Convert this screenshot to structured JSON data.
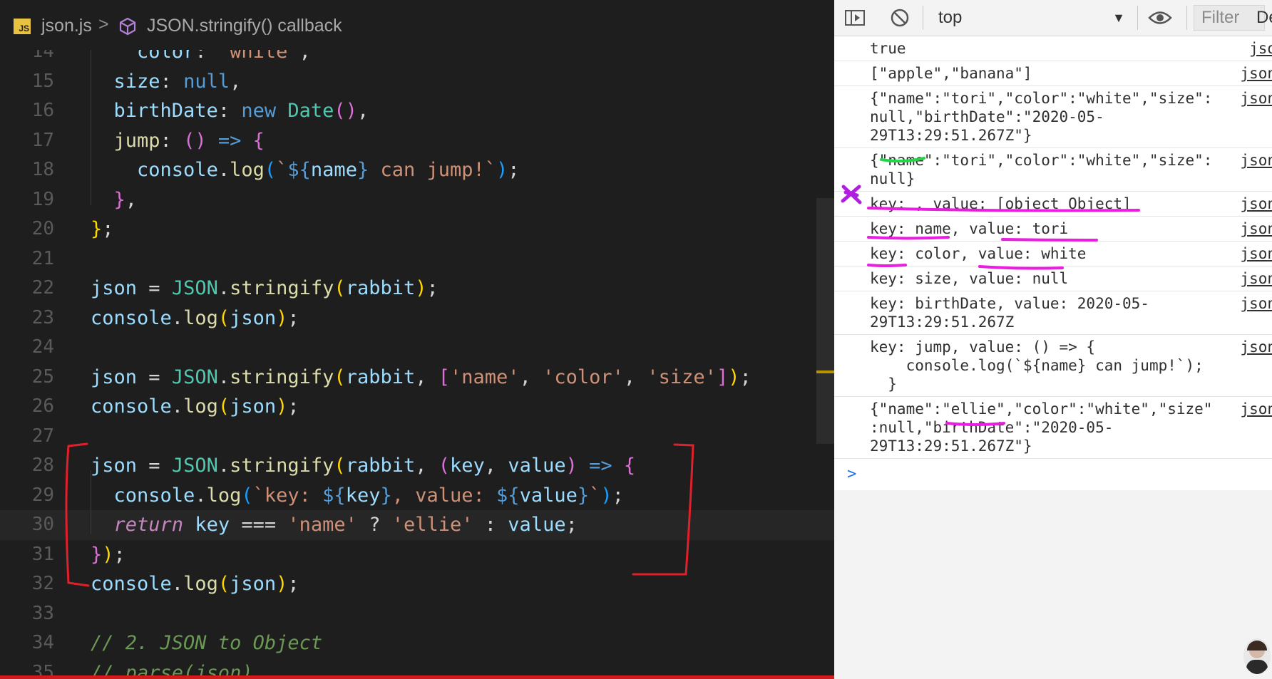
{
  "editor": {
    "breadcrumb": {
      "file_badge": "JS",
      "file": "json.js",
      "separator": ">",
      "symbol": "JSON.stringify() callback"
    }
  },
  "console": {
    "toolbar": {
      "context": "top",
      "filter_placeholder": "Filter",
      "more_label": "De"
    },
    "logs": [
      {
        "text": "true",
        "source": "jso"
      },
      {
        "text": "[\"apple\",\"banana\"]",
        "source": "json"
      },
      {
        "text": "{\"name\":\"tori\",\"color\":\"white\",\"size\":\nnull,\"birthDate\":\"2020-05-29T13:29:51.267Z\"}",
        "source": "json"
      },
      {
        "text": "{\"name\":\"tori\",\"color\":\"white\",\"size\":\nnull}",
        "source": "json"
      },
      {
        "text": "key: , value: [object Object]",
        "source": "json"
      },
      {
        "text": "key: name, value: tori",
        "source": "json"
      },
      {
        "text": "key: color, value: white",
        "source": "json"
      },
      {
        "text": "key: size, value: null",
        "source": "json"
      },
      {
        "text": "key: birthDate, value: 2020-05-\n29T13:29:51.267Z",
        "source": "json"
      },
      {
        "text": "key: jump, value: () => {\n    console.log(`${name} can jump!`);\n  }",
        "source": "json"
      },
      {
        "text": "{\"name\":\"ellie\",\"color\":\"white\",\"size\"\n:null,\"birthDate\":\"2020-05-29T13:29:51.267Z\"}",
        "source": "json"
      }
    ],
    "prompt": ">"
  },
  "colors": {
    "editor_bg": "#1e1e1e",
    "console_bg": "#f3f3f3",
    "annotation_red": "#e0202a",
    "annotation_magenta": "#ea1ee0",
    "annotation_green": "#22d648",
    "annotation_purple": "#b01fe0"
  }
}
